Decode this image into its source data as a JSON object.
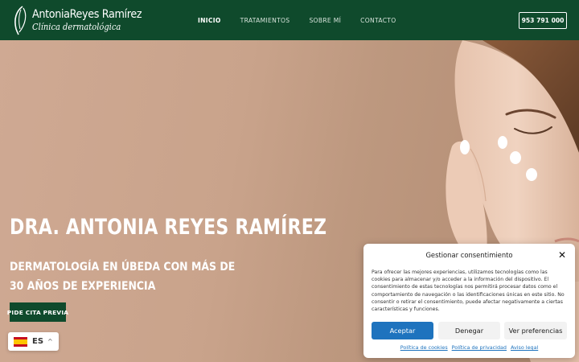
{
  "header": {
    "logo": {
      "name": "AntoniaReyes Ramírez",
      "subtitle": "Clínica dermatológica"
    },
    "nav": [
      {
        "label": "INICIO",
        "active": true
      },
      {
        "label": "TRATAMIENTOS",
        "active": false
      },
      {
        "label": "SOBRE MÍ",
        "active": false
      },
      {
        "label": "CONTACTO",
        "active": false
      }
    ],
    "phone": "953 791 000"
  },
  "hero": {
    "title": "DRA. ANTONIA REYES RAMÍREZ",
    "subtitle_line1": "DERMATOLOGÍA EN ÚBEDA CON MÁS DE",
    "subtitle_line2": "30 AÑOS DE EXPERIENCIA",
    "cta": "PIDE CITA PREVIA"
  },
  "language": {
    "code": "ES",
    "flag_icon": "spain-flag-icon",
    "caret_icon": "chevron-up-icon"
  },
  "consent": {
    "title": "Gestionar consentimiento",
    "close_icon": "close-icon",
    "text": "Para ofrecer las mejores experiencias, utilizamos tecnologías como las cookies para almacenar y/o acceder a la información del dispositivo. El consentimiento de estas tecnologías nos permitirá procesar datos como el comportamiento de navegación o las identificaciones únicas en este sitio. No consentir o retirar el consentimiento, puede afectar negativamente a ciertas características y funciones.",
    "buttons": {
      "accept": "Aceptar",
      "deny": "Denegar",
      "preferences": "Ver preferencias"
    },
    "links": [
      "Política de cookies",
      "Política de privacidad",
      "Aviso legal"
    ]
  },
  "colors": {
    "brand_green": "#0f4a2c",
    "accept_blue": "#1e73be",
    "link_blue": "#1e73be"
  }
}
